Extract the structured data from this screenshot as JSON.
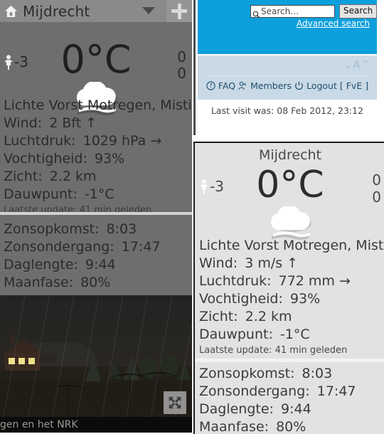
{
  "left_widget": {
    "home_icon": "home-icon",
    "city": "Mijdrecht",
    "dropdown_icon": "chevron-down-icon",
    "add_icon": "plus-icon",
    "feels_icon": "pedestrian-icon",
    "feels_like": "-3",
    "temperature": "0°C",
    "precip_top": "0",
    "precip_bottom": "0",
    "weather_icon": "cloud-fog-icon",
    "description": "Lichte Vorst Motregen, Mistig",
    "rows": [
      {
        "label": "Wind:",
        "value": "2 Bft",
        "trend": "↑",
        "name": "wind-row"
      },
      {
        "label": "Luchtdruk:",
        "value": "1029 hPa",
        "trend": "→",
        "name": "pressure-row"
      },
      {
        "label": "Vochtigheid:",
        "value": "93%",
        "trend": "",
        "name": "humidity-row"
      },
      {
        "label": "Zicht:",
        "value": "2.2 km",
        "trend": "",
        "name": "visibility-row"
      },
      {
        "label": "Dauwpunt:",
        "value": "-1°C",
        "trend": "",
        "name": "dewpoint-row"
      }
    ],
    "update_label": "Laatste update:",
    "update_value": "41 min geleden",
    "astro": [
      {
        "label": "Zonsopkomst:",
        "value": "8:03",
        "name": "sunrise-row"
      },
      {
        "label": "Zonsondergang:",
        "value": "17:47",
        "name": "sunset-row"
      },
      {
        "label": "Daglengte:",
        "value": "9:44",
        "name": "daylength-row"
      },
      {
        "label": "Maanfase:",
        "value": "80%",
        "name": "moonphase-row"
      }
    ]
  },
  "photo": {
    "caption": "gen en het NRK",
    "expand_icon": "expand-arrows-icon"
  },
  "forum": {
    "search_icon": "magnifier-icon",
    "search_placeholder": "Search…",
    "search_button": "Search",
    "advanced_search": "Advanced search",
    "font_size_control": "⌄A⌃",
    "links": [
      {
        "icon": "question-mark-icon",
        "label": "FAQ",
        "name": "faq-link"
      },
      {
        "icon": "members-icon",
        "label": "Members",
        "name": "members-link"
      },
      {
        "icon": "power-icon",
        "label": "Logout",
        "name": "logout-link"
      }
    ],
    "user_bracket": "[ FvE ]",
    "last_visit": "Last visit was: 08 Feb 2012, 23:12"
  },
  "right_widget": {
    "city": "Mijdrecht",
    "feels_icon": "pedestrian-icon",
    "feels_like": "-3",
    "temperature": "0°C",
    "precip_top": "0",
    "precip_bottom": "0",
    "weather_icon": "cloud-fog-icon",
    "description": "Lichte Vorst Motregen, Mistig",
    "rows": [
      {
        "label": "Wind:",
        "value": "3 m/s",
        "trend": "↑",
        "name": "wind-row"
      },
      {
        "label": "Luchtdruk:",
        "value": "772 mm",
        "trend": "→",
        "name": "pressure-row"
      },
      {
        "label": "Vochtigheid:",
        "value": "93%",
        "trend": "",
        "name": "humidity-row"
      },
      {
        "label": "Zicht:",
        "value": "2.2 km",
        "trend": "",
        "name": "visibility-row"
      },
      {
        "label": "Dauwpunt:",
        "value": "-1°C",
        "trend": "",
        "name": "dewpoint-row"
      }
    ],
    "update_label": "Laatste update:",
    "update_value": "41 min geleden",
    "astro": [
      {
        "label": "Zonsopkomst:",
        "value": "8:03",
        "name": "sunrise-row"
      },
      {
        "label": "Zonsondergang:",
        "value": "17:47",
        "name": "sunset-row"
      },
      {
        "label": "Daglengte:",
        "value": "9:44",
        "name": "daylength-row"
      },
      {
        "label": "Maanfase:",
        "value": "80%",
        "name": "moonphase-row"
      }
    ]
  },
  "colors": {
    "forum_blue": "#0d9fdb",
    "forum_bar": "#c9d9e5",
    "dark_widget_bg": "#6e6e6e",
    "light_widget_bg": "#e2e2e2"
  }
}
